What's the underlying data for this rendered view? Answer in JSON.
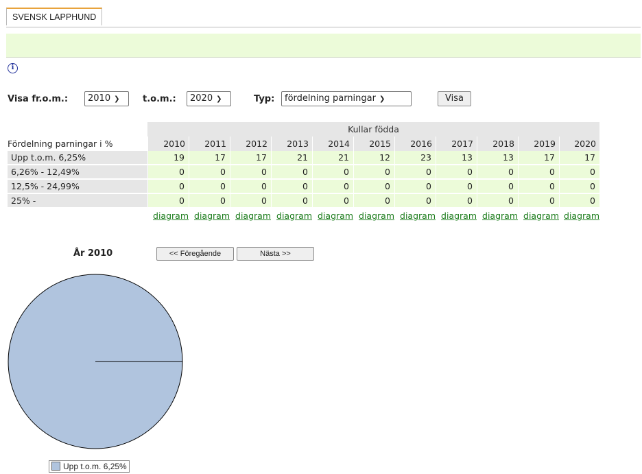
{
  "tab": {
    "label": "SVENSK LAPPHUND"
  },
  "filters": {
    "from_label": "Visa fr.o.m.:",
    "from_value": "2010",
    "to_label": "t.o.m.:",
    "to_value": "2020",
    "type_label": "Typ:",
    "type_value": "fördelning parningar",
    "show_button": "Visa"
  },
  "table": {
    "group_header": "Kullar födda",
    "row_header": "Fördelning parningar i %",
    "years": [
      "2010",
      "2011",
      "2012",
      "2013",
      "2014",
      "2015",
      "2016",
      "2017",
      "2018",
      "2019",
      "2020"
    ],
    "rows": [
      {
        "label": "Upp t.o.m. 6,25%",
        "values": [
          "19",
          "17",
          "17",
          "21",
          "21",
          "12",
          "23",
          "13",
          "13",
          "17",
          "17"
        ]
      },
      {
        "label": "6,26% - 12,49%",
        "values": [
          "0",
          "0",
          "0",
          "0",
          "0",
          "0",
          "0",
          "0",
          "0",
          "0",
          "0"
        ]
      },
      {
        "label": "12,5% - 24,99%",
        "values": [
          "0",
          "0",
          "0",
          "0",
          "0",
          "0",
          "0",
          "0",
          "0",
          "0",
          "0"
        ]
      },
      {
        "label": "25% -",
        "values": [
          "0",
          "0",
          "0",
          "0",
          "0",
          "0",
          "0",
          "0",
          "0",
          "0",
          "0"
        ]
      }
    ],
    "link_label": "diagram"
  },
  "chart_section": {
    "year_title": "År 2010",
    "prev_button": "<< Föregående",
    "next_button": "Nästa >>"
  },
  "chart_data": {
    "type": "pie",
    "categories": [
      "Upp t.o.m. 6,25%"
    ],
    "values": [
      19
    ],
    "colors": [
      "#b0c4de"
    ]
  },
  "legend": {
    "label": "Upp t.o.m. 6,25%"
  },
  "icons": {
    "info": "info-icon"
  },
  "colors": {
    "tab_accent": "#e8a33b",
    "green_panel": "#ecfbd9",
    "link": "#1a7b1a"
  }
}
